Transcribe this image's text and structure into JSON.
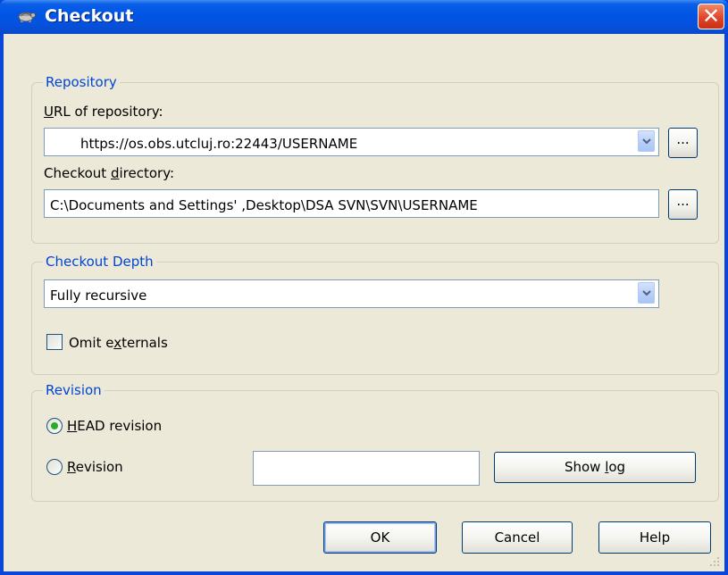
{
  "window": {
    "title": "Checkout",
    "close_label": "✕"
  },
  "repository": {
    "group_label": "Repository",
    "url_label_accel": "U",
    "url_label_rest": "RL of repository:",
    "url_value": "https://os.obs.utcluj.ro:22443/USERNAME",
    "dir_label_pre": "Checkout ",
    "dir_label_accel": "d",
    "dir_label_post": "irectory:",
    "dir_value": "C:\\Documents and Settings' ,Desktop\\DSA SVN\\SVN\\USERNAME",
    "browse_label": "..."
  },
  "depth": {
    "group_label": "Checkout Depth",
    "selected": "Fully recursive",
    "omit_pre": "Omit e",
    "omit_accel": "x",
    "omit_post": "ternals",
    "omit_checked": false
  },
  "revision": {
    "group_label": "Revision",
    "head_accel": "H",
    "head_rest": "EAD revision",
    "rev_accel": "R",
    "rev_rest": "evision",
    "rev_value": "",
    "showlog_pre": "Show ",
    "showlog_accel": "l",
    "showlog_post": "og",
    "selected": "HEAD revision"
  },
  "buttons": {
    "ok": "OK",
    "cancel": "Cancel",
    "help": "Help"
  },
  "colors": {
    "title_bar": "#0055e5",
    "group_label": "#0046d5",
    "dialog_bg": "#ece9d8",
    "close_button": "#e0452a"
  }
}
